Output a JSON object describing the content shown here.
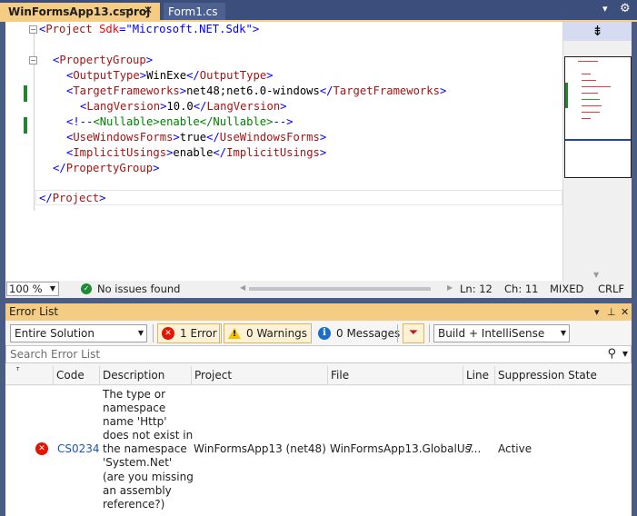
{
  "tabs": {
    "active": "WinFormsApp13.csproj",
    "inactive": "Form1.cs"
  },
  "editor": {
    "lines": [
      "<Project Sdk=\"Microsoft.NET.Sdk\">",
      "",
      "<PropertyGroup>",
      "<OutputType>WinExe</OutputType>",
      "<TargetFrameworks>net48;net6.0-windows</TargetFrameworks>",
      "<LangVersion>10.0</LangVersion>",
      "<!--<Nullable>enable</Nullable>-->",
      "<UseWindowsForms>true</UseWindowsForms>",
      "<ImplicitUsings>enable</ImplicitUsings>",
      "</PropertyGroup>",
      "",
      "</Project>"
    ]
  },
  "status": {
    "zoom": "100 %",
    "issues": "No issues found",
    "line": "Ln: 12",
    "col": "Ch: 11",
    "tabs": "MIXED",
    "eol": "CRLF"
  },
  "error_list": {
    "title": "Error List",
    "scope": "Entire Solution",
    "errors_btn": "1 Error",
    "warnings_btn": "0 Warnings",
    "messages_btn": "0 Messages",
    "build_filter": "Build + IntelliSense",
    "search_placeholder": "Search Error List",
    "columns": [
      "Code",
      "Description",
      "Project",
      "File",
      "Line",
      "Suppression State"
    ],
    "rows": [
      {
        "code": "CS0234",
        "description": "The type or namespace name 'Http' does not exist in the namespace 'System.Net' (are you missing an assembly reference?)",
        "project": "WinFormsApp13 (net48)",
        "file": "WinFormsApp13.GlobalUs...",
        "line": "7",
        "suppression": "Active"
      }
    ]
  },
  "colors": {
    "accent_gold": "#f5cc84",
    "chrome_blue": "#3c4e7b",
    "error_red": "#e51400",
    "change_green": "#21842e"
  },
  "icons": [
    "pin-icon",
    "close-icon",
    "dropdown-icon",
    "gear-icon",
    "split-icon",
    "ok-check-icon",
    "error-icon",
    "warning-icon",
    "info-icon",
    "filter-funnel-icon",
    "search-icon"
  ]
}
